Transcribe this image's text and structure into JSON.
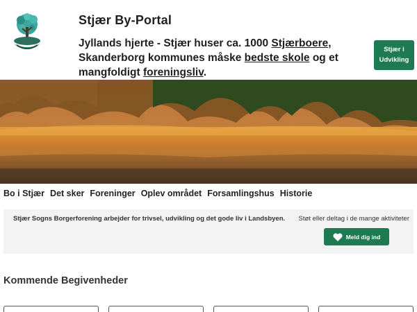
{
  "header": {
    "title": "Stjær By-Portal",
    "tagline_part1": "Jyllands hjerte - Stjær huser ca. 1000 ",
    "tagline_link1": "Stjærboere",
    "tagline_part2": ", Skanderborg kommunes måske ",
    "tagline_link2": "bedste skole",
    "tagline_part3": " og et mangfoldigt ",
    "tagline_link3": "foreningsliv",
    "tagline_part4": ".",
    "cta_line1": "Stjær i",
    "cta_line2": "Udvikling"
  },
  "nav": {
    "items": [
      {
        "label": "Bo i Stjær"
      },
      {
        "label": "Det sker"
      },
      {
        "label": "Foreninger"
      },
      {
        "label": "Oplev området"
      },
      {
        "label": "Forsamlingshus"
      },
      {
        "label": "Historie"
      }
    ]
  },
  "info": {
    "text": "Stjær Sogns Borgerforening arbejder for trivsel, udvikling og det gode liv i Landsbyen.",
    "support_text": "Støt eller deltag i de mange aktiviteter",
    "join_label": "Meld dig ind"
  },
  "events": {
    "title": "Kommende Begivenheder"
  },
  "colors": {
    "accent": "#1e7a50",
    "panel": "#f3f3f3"
  }
}
